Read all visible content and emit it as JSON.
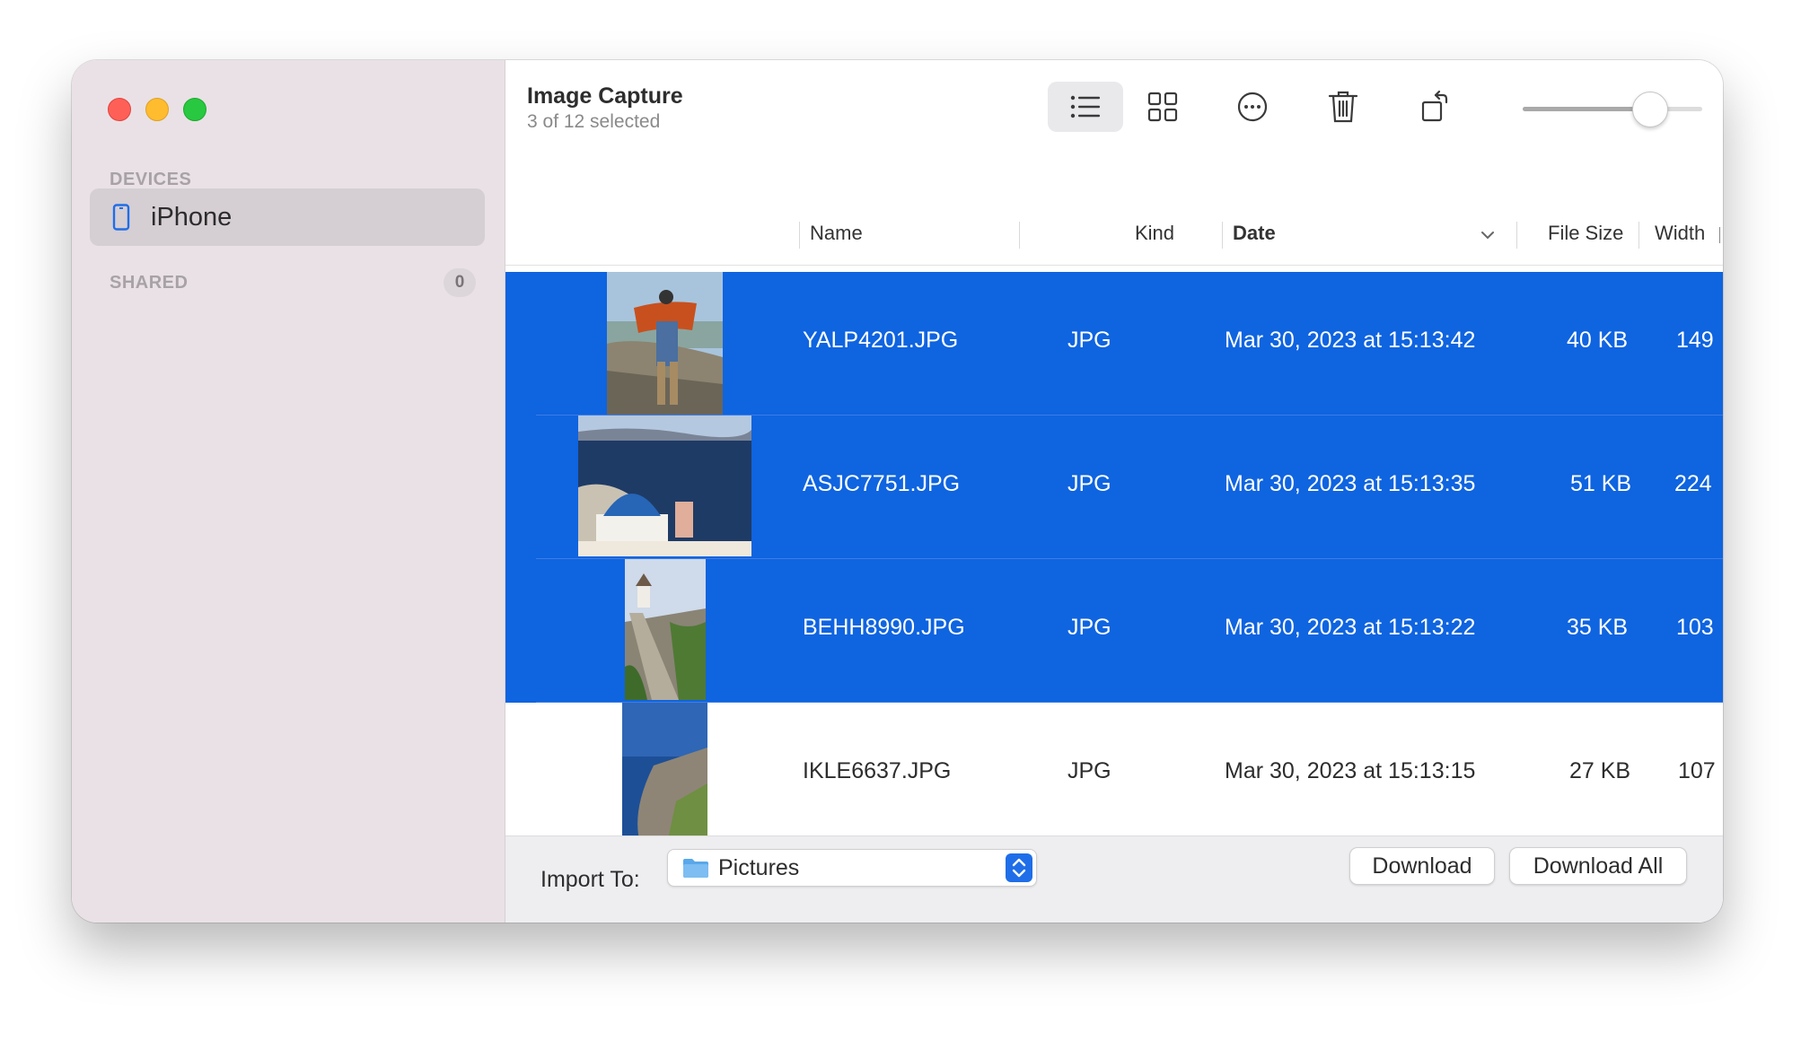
{
  "window": {
    "title": "Image Capture",
    "subtitle": "3 of 12 selected"
  },
  "sidebar": {
    "devices_label": "DEVICES",
    "device_name": "iPhone",
    "shared_label": "SHARED",
    "shared_count": "0"
  },
  "toolbar": {
    "view_mode": "list",
    "icons": [
      "list-view-icon",
      "grid-view-icon",
      "more-icon",
      "trash-icon",
      "rotate-icon"
    ],
    "thumbnail_size_fraction": 0.75
  },
  "columns": {
    "name": "Name",
    "kind": "Kind",
    "date": "Date",
    "file_size": "File Size",
    "width": "Width"
  },
  "rows": [
    {
      "name": "YALP4201.JPG",
      "kind": "JPG",
      "date": "Mar 30, 2023 at 15:13:42",
      "size": "40 KB",
      "width": "149",
      "selected": true
    },
    {
      "name": "ASJC7751.JPG",
      "kind": "JPG",
      "date": "Mar 30, 2023 at 15:13:35",
      "size": "51 KB",
      "width": "224",
      "selected": true
    },
    {
      "name": "BEHH8990.JPG",
      "kind": "JPG",
      "date": "Mar 30, 2023 at 15:13:22",
      "size": "35 KB",
      "width": "103",
      "selected": true
    },
    {
      "name": "IKLE6637.JPG",
      "kind": "JPG",
      "date": "Mar 30, 2023 at 15:13:15",
      "size": "27 KB",
      "width": "107",
      "selected": false
    }
  ],
  "footer": {
    "import_label": "Import To:",
    "destination": "Pictures",
    "download_label": "Download",
    "download_all_label": "Download All"
  },
  "colors": {
    "selection": "#0f64e0",
    "sidebar_bg": "#e9e1e6",
    "accent": "#1f6ee8"
  }
}
